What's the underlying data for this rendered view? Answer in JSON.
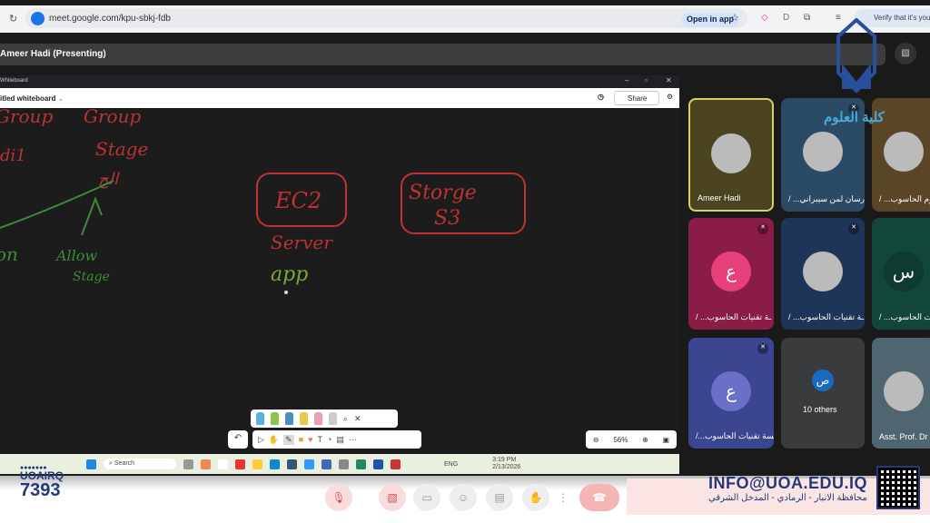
{
  "browser": {
    "url": "meet.google.com/kpu-sbkj-fdb",
    "open_in_app": "Open in app",
    "verify": "Verify that it's you"
  },
  "meet": {
    "presenting": "Ameer Hadi (Presenting)"
  },
  "whiteboard": {
    "window_title": "Whiteboard",
    "doc_title": "itled whiteboard",
    "share": "Share",
    "zoom": "56%",
    "handwriting": [
      "Group",
      "Stage",
      "on",
      "Allow",
      "Stage",
      "EC2",
      "Server",
      "app",
      "Storge",
      "S3",
      "di1",
      "الج"
    ]
  },
  "taskbar": {
    "search": "Search",
    "lang": "ENG",
    "time": "3:19 PM",
    "date": "2/13/2026"
  },
  "participants": [
    {
      "name": "Ameer Hadi",
      "initial": "",
      "color": "#4a4520"
    },
    {
      "name": "/ ...درسان لمن سيبراني",
      "initial": "",
      "color": "#2b4a66"
    },
    {
      "name": "/ ...ن علوم الحاسوب",
      "initial": "",
      "color": "#5a4526"
    },
    {
      "name": "/ ...ـة تقنيات الحاسوب",
      "initial": "ع",
      "color": "#8a1c48"
    },
    {
      "name": "/ ...ـة تقنيات الحاسوب",
      "initial": "",
      "color": "#1d3558"
    },
    {
      "name": "/ ...تقنيات الحاسوب",
      "initial": "س",
      "color": "#12463a"
    },
    {
      "name": "/...ـسة تقنيات الحاسوب",
      "initial": "ع",
      "color": "#3b4590"
    },
    {
      "name": "10 others",
      "initial": "ص",
      "color": "#3a3b3d"
    },
    {
      "name": "Asst. Prof. Dr",
      "initial": "",
      "color": "#4f6670"
    }
  ],
  "branding": {
    "college": "كلية العلوم",
    "handle": "UOAIRQ",
    "number": "7393",
    "email": "INFO@UOA.EDU.IQ",
    "address": "محافظة الانبار - الرمادي - المدخل الشرقي"
  },
  "colors": {
    "accent": "#1a73e8",
    "ink_red": "#c0392b",
    "ink_green": "#3d8a3a",
    "brand": "#233a7a"
  }
}
